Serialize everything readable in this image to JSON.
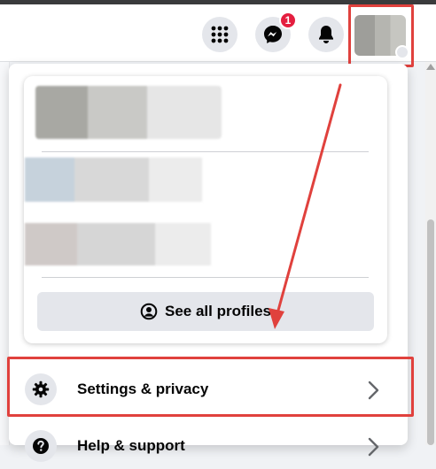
{
  "header": {
    "messenger_badge": "1"
  },
  "menu": {
    "see_all_profiles": "See all profiles",
    "settings_privacy": "Settings & privacy",
    "help_support": "Help & support"
  },
  "colors": {
    "annotation_red": "#e0413d",
    "badge_red": "#e41e3f",
    "button_gray": "#e4e6eb"
  },
  "icons": [
    "menu-grid-icon",
    "messenger-icon",
    "bell-icon",
    "gear-icon",
    "profile-circle-icon",
    "question-icon",
    "chevron-right-icon"
  ]
}
